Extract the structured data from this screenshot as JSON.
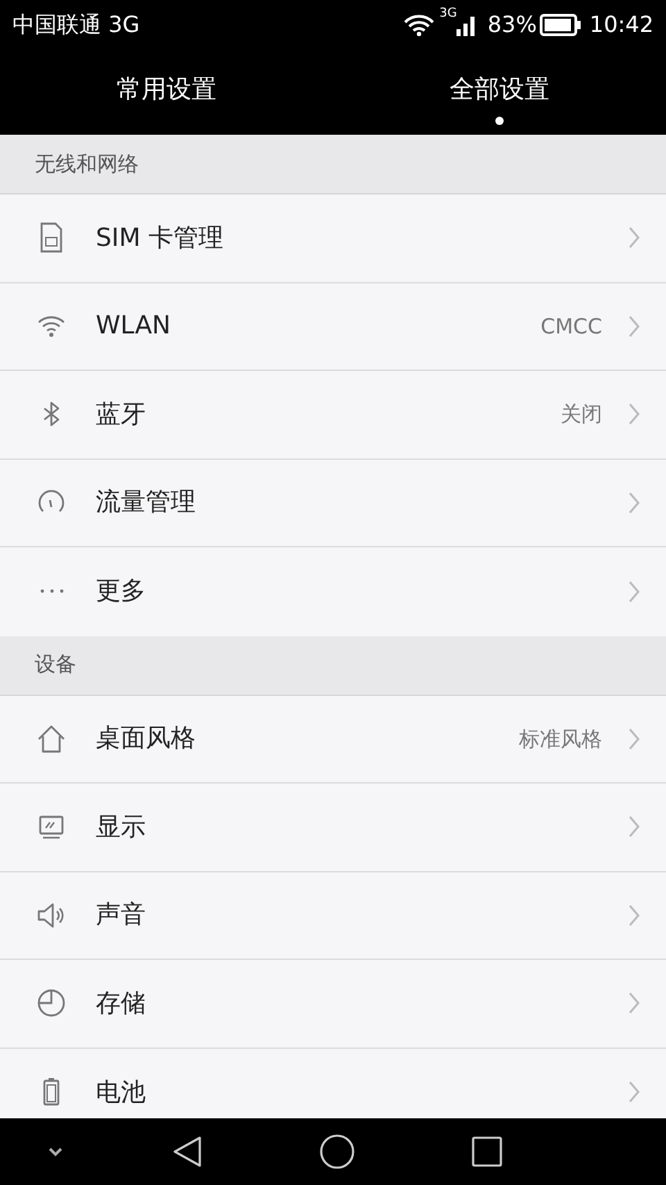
{
  "status_bar": {
    "carrier": "中国联通 3G",
    "network_badge": "3G",
    "battery": "83%",
    "time": "10:42"
  },
  "tabs": [
    {
      "label": "常用设置",
      "selected": false
    },
    {
      "label": "全部设置",
      "selected": true
    }
  ],
  "sections": [
    {
      "title": "无线和网络",
      "items": [
        {
          "kind": "sim",
          "label": "SIM 卡管理"
        },
        {
          "kind": "wifi",
          "label": "WLAN",
          "value": "CMCC"
        },
        {
          "kind": "bluetooth",
          "label": "蓝牙",
          "value": "关闭"
        },
        {
          "kind": "data",
          "label": "流量管理"
        },
        {
          "kind": "more",
          "label": "更多"
        }
      ]
    },
    {
      "title": "设备",
      "items": [
        {
          "kind": "home",
          "label": "桌面风格",
          "value": "标准风格"
        },
        {
          "kind": "display",
          "label": "显示"
        },
        {
          "kind": "sound",
          "label": "声音"
        },
        {
          "kind": "storage",
          "label": "存储"
        },
        {
          "kind": "battery",
          "label": "电池"
        }
      ]
    }
  ]
}
